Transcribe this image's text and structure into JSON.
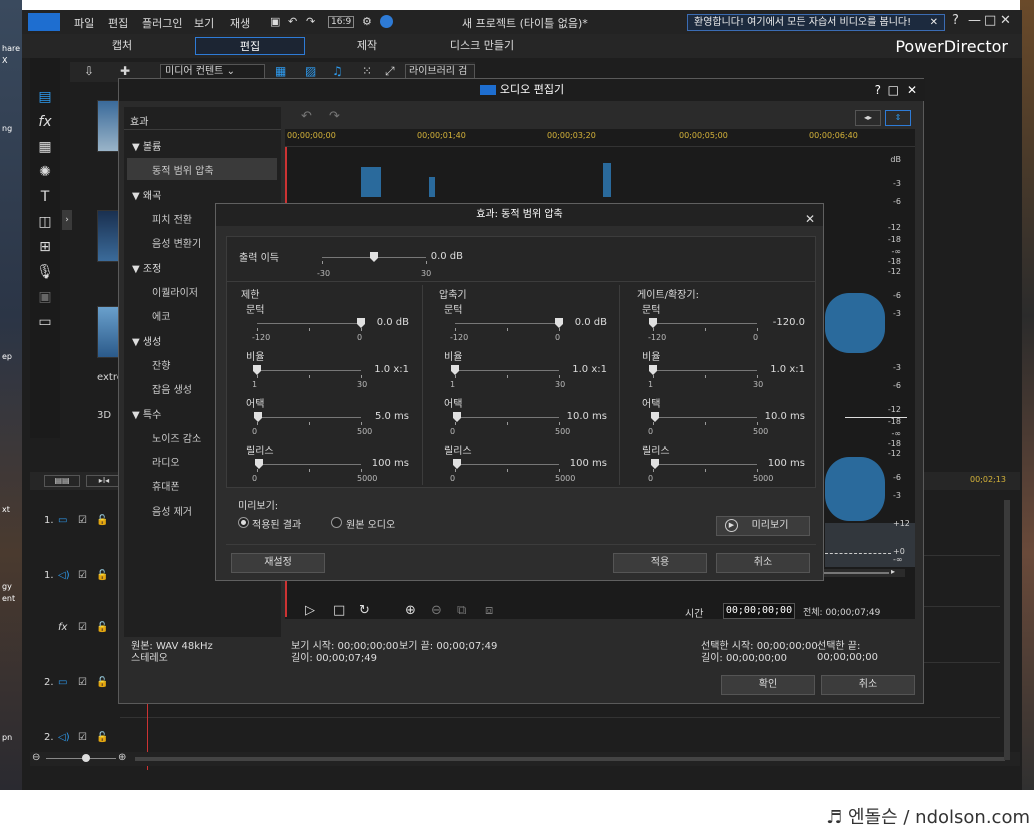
{
  "desktop": {
    "left_labels": [
      "hare",
      "X",
      "ng",
      "ep",
      "xt",
      "gy",
      "ent",
      "pn"
    ]
  },
  "app": {
    "menu": [
      "파일",
      "편집",
      "플러그인",
      "보기",
      "재생"
    ],
    "project_title": "새 프로젝트 (타이틀 없음)*",
    "ratio": "16:9",
    "welcome": "환영합니다! 여기에서 모든 자습서 비디오를 봅니다!",
    "tabs": [
      "캡처",
      "편집",
      "제작",
      "디스크 만들기"
    ],
    "brand": "PowerDirector",
    "media_dropdown": "미디어 컨텐트",
    "library_search": "라이브러리 검",
    "thumb_labels": [
      "extre",
      "3D"
    ],
    "tracks": [
      "1.",
      "1.",
      "fx",
      "2.",
      "2."
    ],
    "timeline_time": "00;02;13"
  },
  "audio_editor": {
    "title": "오디오 편집기",
    "effects_header": "효과",
    "groups": [
      {
        "name": "볼륨",
        "items": [
          "동적 범위 압축"
        ]
      },
      {
        "name": "왜곡",
        "items": [
          "피치 전환",
          "음성 변환기"
        ]
      },
      {
        "name": "조정",
        "items": [
          "이퀄라이저",
          "에코"
        ]
      },
      {
        "name": "생성",
        "items": [
          "잔향",
          "잡음 생성"
        ]
      },
      {
        "name": "특수",
        "items": [
          "노이즈 감소",
          "라디오",
          "휴대폰",
          "음성 제거"
        ]
      }
    ],
    "ruler": [
      "00;00;00;00",
      "00;00;01;40",
      "00;00;03;20",
      "00;00;05;00",
      "00;00;06;40"
    ],
    "db_label": "dB",
    "db_ticks_top": [
      "-3",
      "-6",
      "-12",
      "-18",
      "-∞",
      "-18",
      "-12",
      "-6",
      "-3"
    ],
    "db_ticks_bottom": [
      "-3",
      "-6",
      "-12",
      "-18",
      "-∞",
      "-18",
      "-12",
      "-6",
      "-3"
    ],
    "env_ticks": [
      "+12",
      "+0",
      "-∞"
    ],
    "time_label": "시간",
    "time_value": "00;00;00;00",
    "total": "전체: 00;00;07;49",
    "source": "원본: WAV 48kHz",
    "channels": "스테레오",
    "view_start": "보기 시작: 00;00;00;00",
    "view_end": "보기 끝: 00;00;07;49",
    "length": "길이: 00;00;07;49",
    "sel_start": "선택한 시작: 00;00;00;00",
    "sel_end": "선택한 끝: 00;00;00;00",
    "sel_length": "길이: 00;00;00;00",
    "ok": "확인",
    "cancel": "취소"
  },
  "compressor": {
    "title": "효과: 동적 범위 압축",
    "output_gain": {
      "label": "출력 이득",
      "value": "0.0 dB",
      "min": "-30",
      "max": "30",
      "position": 0.5
    },
    "columns": [
      {
        "title": "제한",
        "sliders": [
          {
            "label": "문턱",
            "value": "0.0 dB",
            "min": "-120",
            "max": "0",
            "position": 1.0
          },
          {
            "label": "비율",
            "value": "1.0 x:1",
            "min": "1",
            "max": "30",
            "position": 0.0
          },
          {
            "label": "어택",
            "value": "5.0 ms",
            "min": "0",
            "max": "500",
            "position": 0.01
          },
          {
            "label": "릴리스",
            "value": "100 ms",
            "min": "0",
            "max": "5000",
            "position": 0.02
          }
        ]
      },
      {
        "title": "압축기",
        "sliders": [
          {
            "label": "문턱",
            "value": "0.0 dB",
            "min": "-120",
            "max": "0",
            "position": 1.0
          },
          {
            "label": "비율",
            "value": "1.0 x:1",
            "min": "1",
            "max": "30",
            "position": 0.0
          },
          {
            "label": "어택",
            "value": "10.0 ms",
            "min": "0",
            "max": "500",
            "position": 0.02
          },
          {
            "label": "릴리스",
            "value": "100 ms",
            "min": "0",
            "max": "5000",
            "position": 0.02
          }
        ]
      },
      {
        "title": "게이트/확장기:",
        "sliders": [
          {
            "label": "문턱",
            "value": "-120.0",
            "min": "-120",
            "max": "0",
            "position": 0.0
          },
          {
            "label": "비율",
            "value": "1.0 x:1",
            "min": "1",
            "max": "30",
            "position": 0.0
          },
          {
            "label": "어택",
            "value": "10.0 ms",
            "min": "0",
            "max": "500",
            "position": 0.02
          },
          {
            "label": "릴리스",
            "value": "100 ms",
            "min": "0",
            "max": "5000",
            "position": 0.02
          }
        ]
      }
    ],
    "preview_label": "미리보기:",
    "radio_applied": "적용된 결과",
    "radio_original": "원본 오디오",
    "preview_button": "미리보기",
    "reset": "재설정",
    "apply": "적용",
    "cancel": "취소"
  },
  "watermark": "♬ 엔돌슨 / ndolson.com"
}
